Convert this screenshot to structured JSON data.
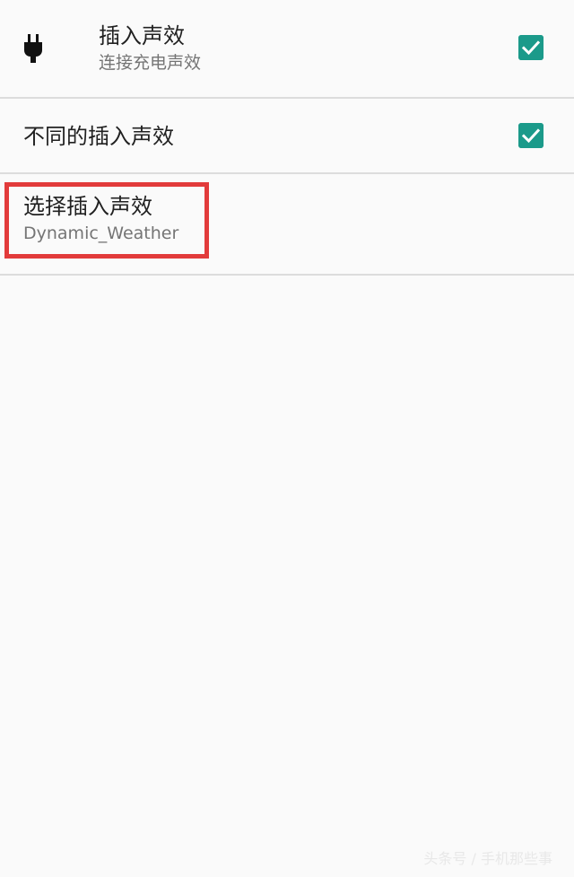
{
  "settings": {
    "plug_sound": {
      "title": "插入声效",
      "summary": "连接充电声效",
      "checked": true,
      "icon": "plug-icon"
    },
    "different_plug_sound": {
      "title": "不同的插入声效",
      "checked": true
    },
    "select_plug_sound": {
      "title": "选择插入声效",
      "summary": "Dynamic_Weather"
    }
  },
  "colors": {
    "accent": "#1b9a8a",
    "highlight": "#e23b3b",
    "divider": "#dcdcdc",
    "background": "#fafafa"
  },
  "watermark": "头条号 / 手机那些事"
}
